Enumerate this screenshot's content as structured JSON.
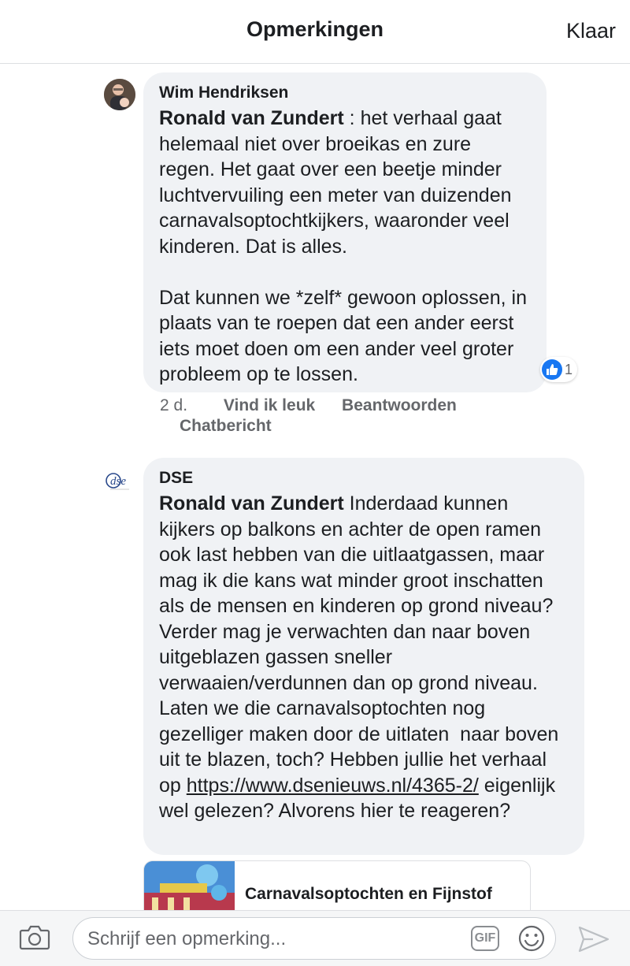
{
  "header": {
    "title": "Opmerkingen",
    "done_label": "Klaar"
  },
  "comments": [
    {
      "author": "Wim Hendriksen",
      "mention": "Ronald van Zundert",
      "text_after_mention": " : het verhaal gaat helemaal niet over broeikas en zure regen. Het gaat over een beetje minder luchtvervuiling een meter van duizenden carnavalsoptochtkijkers, waaronder veel kinderen. Dat is alles.\n\nDat kunnen we *zelf* gewoon oplossen, in plaats van te roepen dat een ander eerst iets moet doen om een ander veel groter probleem op te lossen.",
      "reaction_count": "1",
      "time": "2 d.",
      "like_label": "Vind ik leuk",
      "reply_label": "Beantwoorden",
      "message_label": "Chatbericht"
    },
    {
      "author": "DSE",
      "mention": "Ronald van Zundert",
      "text_after_mention": " Inderdaad kunnen kijkers op balkons en achter de open ramen ook last hebben van die uitlaatgassen, maar mag ik die kans wat minder groot inschatten als de mensen en kinderen op grond niveau? Verder mag je verwachten dan naar boven uitgeblazen gassen sneller verwaaien/verdunnen dan op grond niveau. Laten we die carnavalsoptochten nog gezelliger maken door de uitlaten  naar boven uit te blazen, toch? Hebben jullie het verhaal op ",
      "link_text": "https://www.dsenieuws.nl/4365-2/",
      "text_after_link": " eigenlijk wel gelezen? Alvorens hier te reageren?",
      "avatar_text": "dse"
    }
  ],
  "link_preview": {
    "title": "Carnavalsoptochten en Fijnstof"
  },
  "composer": {
    "placeholder": "Schrijf een opmerking...",
    "gif_label": "GIF"
  },
  "icons": {
    "camera": "camera-icon",
    "emoji": "smiley-icon",
    "send": "send-icon",
    "like": "thumbs-up-icon"
  },
  "colors": {
    "like_blue": "#1877f2",
    "bubble_bg": "#f0f2f5",
    "secondary_text": "#65676b"
  }
}
